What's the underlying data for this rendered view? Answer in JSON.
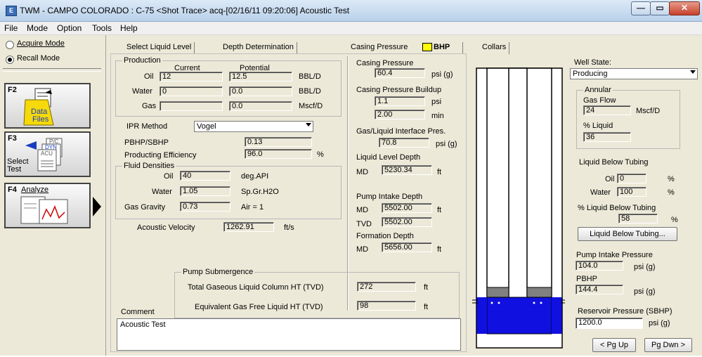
{
  "window": {
    "app_icon_letter": "E",
    "title": "TWM  -  CAMPO COLORADO : C-75  <Shot Trace>  acq-[02/16/11 09:20:06]  Acoustic Test",
    "minimize": "—",
    "restore": "▭",
    "close": "✕"
  },
  "menu": [
    "File",
    "Mode",
    "Option",
    "Tools",
    "Help"
  ],
  "sidebar": {
    "modes": [
      {
        "label": "Acquire Mode",
        "selected": false
      },
      {
        "label": "Recall Mode",
        "selected": true
      }
    ],
    "f2": {
      "key": "F2",
      "label_line1": "Data",
      "label_line2": "Files"
    },
    "f3": {
      "key": "F3",
      "label_line1": "Select",
      "label_line2": "Test",
      "chip_pc": "P/C",
      "chip_dyn": "DYN",
      "chip_acu": "ACU"
    },
    "f4": {
      "key": "F4",
      "label": "Analyze"
    }
  },
  "tabs": [
    {
      "label": "Select Liquid Level",
      "active": false
    },
    {
      "label": "Depth Determination",
      "active": false
    },
    {
      "label": "Casing Pressure",
      "active": false
    },
    {
      "label": "BHP",
      "active": true
    },
    {
      "label": "Collars",
      "active": false
    }
  ],
  "production": {
    "title": "Production",
    "col_current": "Current",
    "col_potential": "Potential",
    "rows": [
      {
        "label": "Oil",
        "current": "12",
        "potential": "12.5",
        "unit": "BBL/D"
      },
      {
        "label": "Water",
        "current": "0",
        "potential": "0.0",
        "unit": "BBL/D"
      },
      {
        "label": "Gas",
        "current": "",
        "potential": "0.0",
        "unit": "Mscf/D"
      }
    ]
  },
  "ipr": {
    "label": "IPR Method",
    "value": "Vogel"
  },
  "pbhp_sbhp": {
    "label": "PBHP/SBHP",
    "value": "0.13"
  },
  "prod_eff": {
    "label": "Producting Efficiency",
    "value": "96.0",
    "unit": "%"
  },
  "fluid": {
    "title": "Fluid Densities",
    "oil": {
      "label": "Oil",
      "value": "40",
      "unit": "deg.API"
    },
    "water": {
      "label": "Water",
      "value": "1.05",
      "unit": "Sp.Gr.H2O"
    },
    "gas": {
      "label": "Gas Gravity",
      "value": "0.73",
      "unit": "Air = 1"
    }
  },
  "acoustic": {
    "label": "Acoustic Velocity",
    "value": "1262.91",
    "unit": "ft/s"
  },
  "casing": {
    "cp_label": "Casing Pressure",
    "cp_value": "60.4",
    "cp_unit": "psi (g)",
    "buildup_label": "Casing Pressure Buildup",
    "buildup_value": "1.1",
    "buildup_unit": "psi",
    "buildup_time": "2.00",
    "buildup_time_unit": "min",
    "glip_label": "Gas/Liquid Interface Pres.",
    "glip_value": "70.8",
    "glip_unit": "psi (g)",
    "lld_label": "Liquid Level Depth",
    "lld_md_label": "MD",
    "lld_md": "5230.34",
    "lld_unit": "ft",
    "pid_label": "Pump Intake Depth",
    "pid_md_label": "MD",
    "pid_md": "5502.00",
    "pid_unit": "ft",
    "pid_tvd_label": "TVD",
    "pid_tvd": "5502.00",
    "fd_label": "Formation Depth",
    "fd_md_label": "MD",
    "fd_md": "5656.00",
    "fd_unit": "ft"
  },
  "submergence": {
    "title": "Pump Submergence",
    "total_label": "Total Gaseous Liquid Column HT (TVD)",
    "total_value": "272",
    "total_unit": "ft",
    "equiv_label": "Equivalent Gas Free Liquid HT (TVD)",
    "equiv_value": "98",
    "equiv_unit": "ft"
  },
  "comment": {
    "label": "Comment",
    "value": "Acoustic Test"
  },
  "well_state": {
    "label": "Well State:",
    "value": "Producing",
    "annular_title": "Annular",
    "gas_flow_label": "Gas Flow",
    "gas_flow_value": "24",
    "gas_flow_unit": "Mscf/D",
    "liquid_pct_label": "% Liquid",
    "liquid_pct_value": "36"
  },
  "lbt": {
    "title": "Liquid Below Tubing",
    "oil_label": "Oil",
    "oil_value": "0",
    "oil_unit": "%",
    "water_label": "Water",
    "water_value": "100",
    "water_unit": "%",
    "pct_label": "% Liquid Below Tubing",
    "pct_value": "58",
    "pct_unit": "%",
    "button": "Liquid Below Tubing..."
  },
  "pressures": {
    "pip_label": "Pump Intake Pressure",
    "pip_value": "104.0",
    "pip_unit": "psi (g)",
    "pbhp_label": "PBHP",
    "pbhp_value": "144.4",
    "pbhp_unit": "psi (g)",
    "sbhp_label": "Reservoir Pressure (SBHP)",
    "sbhp_value": "1200.0",
    "sbhp_unit": "psi (g)"
  },
  "nav": {
    "pgup": "< Pg Up",
    "pgdn": "Pg Dwn >"
  },
  "colors": {
    "liquid": "#1010e0",
    "gas_cap": "#808080",
    "bhp_marker": "#ffff00"
  }
}
